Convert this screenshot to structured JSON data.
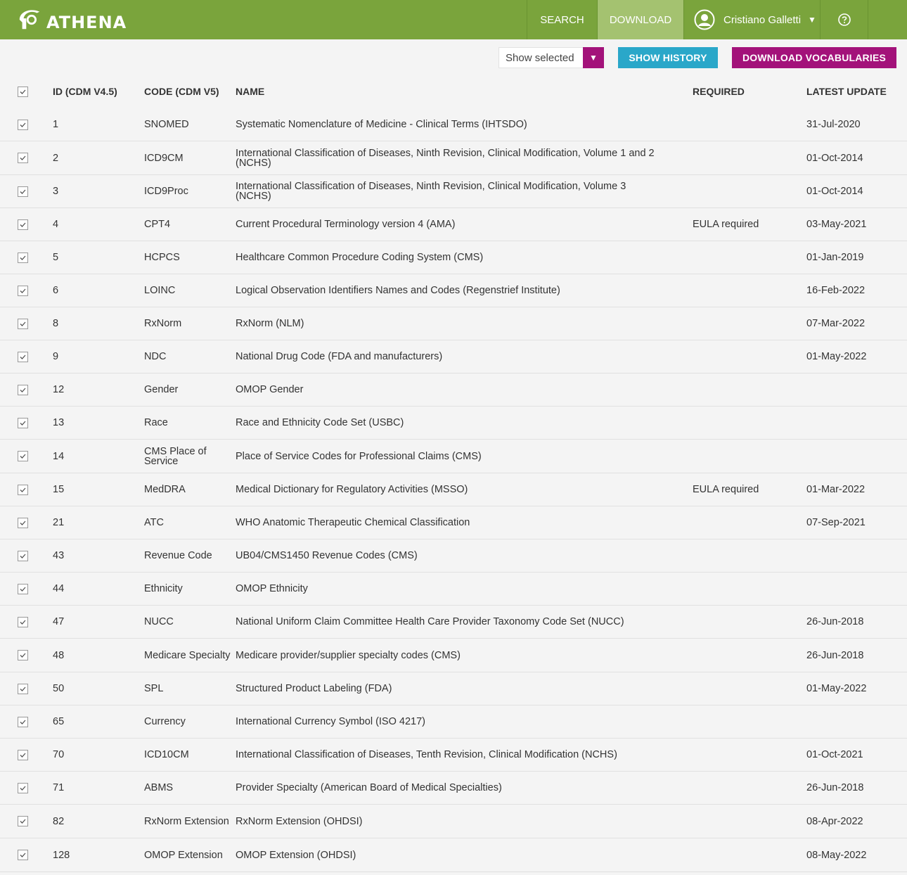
{
  "app": {
    "name": "ATHENA"
  },
  "nav": {
    "search": "SEARCH",
    "download": "DOWNLOAD",
    "user": "Cristiano Galletti"
  },
  "toolbar": {
    "filter_value": "Show selected",
    "history_label": "SHOW HISTORY",
    "download_label": "DOWNLOAD VOCABULARIES"
  },
  "columns": {
    "id": "ID (CDM V4.5)",
    "code": "CODE (CDM V5)",
    "name": "NAME",
    "required": "REQUIRED",
    "updated": "LATEST UPDATE"
  },
  "rows": [
    {
      "id": "1",
      "code": "SNOMED",
      "name": "Systematic Nomenclature of Medicine - Clinical Terms (IHTSDO)",
      "required": "",
      "updated": "31-Jul-2020"
    },
    {
      "id": "2",
      "code": "ICD9CM",
      "name": "International Classification of Diseases, Ninth Revision, Clinical Modification, Volume 1 and 2 (NCHS)",
      "required": "",
      "updated": "01-Oct-2014"
    },
    {
      "id": "3",
      "code": "ICD9Proc",
      "name": "International Classification of Diseases, Ninth Revision, Clinical Modification, Volume 3 (NCHS)",
      "required": "",
      "updated": "01-Oct-2014"
    },
    {
      "id": "4",
      "code": "CPT4",
      "name": "Current Procedural Terminology version 4 (AMA)",
      "required": "EULA required",
      "updated": "03-May-2021"
    },
    {
      "id": "5",
      "code": "HCPCS",
      "name": "Healthcare Common Procedure Coding System (CMS)",
      "required": "",
      "updated": "01-Jan-2019"
    },
    {
      "id": "6",
      "code": "LOINC",
      "name": "Logical Observation Identifiers Names and Codes (Regenstrief Institute)",
      "required": "",
      "updated": "16-Feb-2022"
    },
    {
      "id": "8",
      "code": "RxNorm",
      "name": "RxNorm (NLM)",
      "required": "",
      "updated": "07-Mar-2022"
    },
    {
      "id": "9",
      "code": "NDC",
      "name": "National Drug Code (FDA and manufacturers)",
      "required": "",
      "updated": "01-May-2022"
    },
    {
      "id": "12",
      "code": "Gender",
      "name": "OMOP Gender",
      "required": "",
      "updated": ""
    },
    {
      "id": "13",
      "code": "Race",
      "name": "Race and Ethnicity Code Set (USBC)",
      "required": "",
      "updated": ""
    },
    {
      "id": "14",
      "code": "CMS Place of Service",
      "name": "Place of Service Codes for Professional Claims (CMS)",
      "required": "",
      "updated": ""
    },
    {
      "id": "15",
      "code": "MedDRA",
      "name": "Medical Dictionary for Regulatory Activities (MSSO)",
      "required": "EULA required",
      "updated": "01-Mar-2022"
    },
    {
      "id": "21",
      "code": "ATC",
      "name": "WHO Anatomic Therapeutic Chemical Classification",
      "required": "",
      "updated": "07-Sep-2021"
    },
    {
      "id": "43",
      "code": "Revenue Code",
      "name": "UB04/CMS1450 Revenue Codes (CMS)",
      "required": "",
      "updated": ""
    },
    {
      "id": "44",
      "code": "Ethnicity",
      "name": "OMOP Ethnicity",
      "required": "",
      "updated": ""
    },
    {
      "id": "47",
      "code": "NUCC",
      "name": "National Uniform Claim Committee Health Care Provider Taxonomy Code Set (NUCC)",
      "required": "",
      "updated": "26-Jun-2018"
    },
    {
      "id": "48",
      "code": "Medicare Specialty",
      "name": "Medicare provider/supplier specialty codes (CMS)",
      "required": "",
      "updated": "26-Jun-2018"
    },
    {
      "id": "50",
      "code": "SPL",
      "name": "Structured Product Labeling (FDA)",
      "required": "",
      "updated": "01-May-2022"
    },
    {
      "id": "65",
      "code": "Currency",
      "name": "International Currency Symbol (ISO 4217)",
      "required": "",
      "updated": ""
    },
    {
      "id": "70",
      "code": "ICD10CM",
      "name": "International Classification of Diseases, Tenth Revision, Clinical Modification (NCHS)",
      "required": "",
      "updated": "01-Oct-2021"
    },
    {
      "id": "71",
      "code": "ABMS",
      "name": "Provider Specialty (American Board of Medical Specialties)",
      "required": "",
      "updated": "26-Jun-2018"
    },
    {
      "id": "82",
      "code": "RxNorm Extension",
      "name": "RxNorm Extension (OHDSI)",
      "required": "",
      "updated": "08-Apr-2022"
    },
    {
      "id": "128",
      "code": "OMOP Extension",
      "name": "OMOP Extension (OHDSI)",
      "required": "",
      "updated": "08-May-2022"
    }
  ]
}
